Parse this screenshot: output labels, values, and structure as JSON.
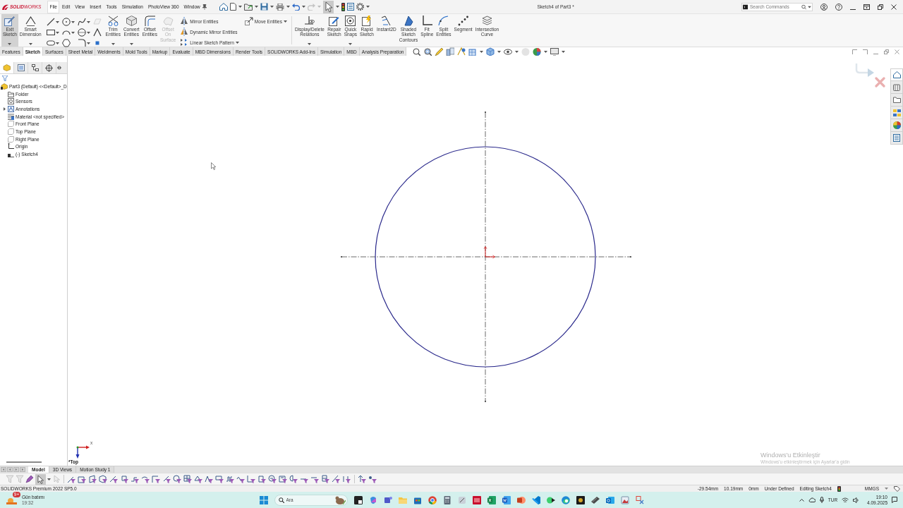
{
  "titlebar": {
    "logo": "**SOLID**WORKS",
    "menu": [
      {
        "label": "File",
        "selected": true
      },
      {
        "label": "Edit",
        "selected": false
      },
      {
        "label": "View",
        "selected": false
      },
      {
        "label": "Insert",
        "selected": false
      },
      {
        "label": "Tools",
        "selected": false
      },
      {
        "label": "Simulation",
        "selected": false
      },
      {
        "label": "PhotoView 360",
        "selected": false
      },
      {
        "label": "Window",
        "selected": false
      }
    ],
    "select_tool": {
      "pressed": true
    },
    "title": "Sketch4 of Part3 *",
    "search": {
      "placeholder": "Search Commands"
    }
  },
  "ribbon": {
    "main_tools": [
      {
        "label": "Exit Sketch",
        "pressed": true,
        "dropdown": true
      },
      {
        "label": "Smart Dimension",
        "pressed": false,
        "dropdown": true
      }
    ],
    "entity_tools": [
      {
        "label": "Trim Entities",
        "disabled": false,
        "dropdown": true
      },
      {
        "label": "Convert Entities",
        "disabled": false,
        "dropdown": true
      },
      {
        "label": "Offset Entities",
        "disabled": false,
        "dropdown": false
      },
      {
        "label": "Offset On Surface",
        "disabled": true,
        "dropdown": false
      }
    ],
    "pattern_tools": [
      {
        "label": "Mirror Entities",
        "dropdown": false
      },
      {
        "label": "Dynamic Mirror Entities",
        "dropdown": false
      },
      {
        "label": "Linear Sketch Pattern",
        "dropdown": true
      }
    ],
    "move_tool": {
      "label": "Move Entities",
      "dropdown": true
    },
    "relation_tools": [
      {
        "label": "Display/Delete Relations",
        "dropdown": true
      },
      {
        "label": "Repair Sketch",
        "dropdown": false
      },
      {
        "label": "Quick Snaps",
        "dropdown": true
      },
      {
        "label": "Rapid Sketch",
        "dropdown": false
      },
      {
        "label": "Instant2D",
        "dropdown": false
      },
      {
        "label": "Shaded Sketch Contours",
        "dropdown": false
      },
      {
        "label": "Fit Spline",
        "dropdown": false
      },
      {
        "label": "Split Entities",
        "dropdown": false
      },
      {
        "label": "Segment",
        "dropdown": false
      },
      {
        "label": "Intersection Curve",
        "dropdown": false
      }
    ]
  },
  "command_tabs": [
    {
      "label": "Features",
      "selected": false
    },
    {
      "label": "Sketch",
      "selected": true
    },
    {
      "label": "Surfaces",
      "selected": false
    },
    {
      "label": "Sheet Metal",
      "selected": false
    },
    {
      "label": "Weldments",
      "selected": false
    },
    {
      "label": "Mold Tools",
      "selected": false
    },
    {
      "label": "Markup",
      "selected": false
    },
    {
      "label": "Evaluate",
      "selected": false
    },
    {
      "label": "MBD Dimensions",
      "selected": false
    },
    {
      "label": "Render Tools",
      "selected": false
    },
    {
      "label": "SOLIDWORKS Add-Ins",
      "selected": false
    },
    {
      "label": "Simulation",
      "selected": false
    },
    {
      "label": "MBD",
      "selected": false
    },
    {
      "label": "Analysis Preparation",
      "selected": false
    }
  ],
  "feature_manager": {
    "tabs": [
      {
        "selected": true
      },
      {
        "selected": false
      },
      {
        "selected": false
      },
      {
        "selected": false
      }
    ],
    "root": {
      "kind": "part",
      "label": "Part3 (Default) <<Default>_D",
      "children": [
        {
          "kind": "folder",
          "label": "Folder"
        },
        {
          "kind": "sensors",
          "label": "Sensors"
        },
        {
          "kind": "annotations",
          "label": "Annotations",
          "expanded": false
        },
        {
          "kind": "material",
          "label": "Material <not specified>"
        },
        {
          "kind": "plane",
          "label": "Front Plane"
        },
        {
          "kind": "plane",
          "label": "Top Plane"
        },
        {
          "kind": "plane",
          "label": "Right Plane"
        },
        {
          "kind": "origin",
          "label": "Origin"
        },
        {
          "kind": "sketch",
          "label": "(-) Sketch4"
        }
      ]
    }
  },
  "graphics_area": {
    "triad_label": "x",
    "view_name": "*Top",
    "activation_notice": {
      "title": "Windows'u Etkinleştir",
      "text": "Windows'u etkinleştirmek için Ayarlar'a gidin"
    }
  },
  "task_pane": {
    "tabs": [
      {
        "selected": true
      },
      {
        "selected": false
      },
      {
        "selected": false
      },
      {
        "selected": false
      },
      {
        "selected": false
      },
      {
        "selected": false
      }
    ]
  },
  "bottom_tabs": [
    {
      "label": "Model",
      "selected": true
    },
    {
      "label": "3D Views",
      "selected": false
    },
    {
      "label": "Motion Study 1",
      "selected": false
    }
  ],
  "selection_filter": {
    "select_pressed": true
  },
  "status_bar": {
    "product": "SOLIDWORKS Premium 2022 SP5.0",
    "coordinates": [
      "-29.54mm",
      "10.19mm",
      "0mm"
    ],
    "sketch_status": "Under Defined",
    "editing": "Editing Sketch4",
    "units": "MMGS"
  },
  "taskbar": {
    "weather": {
      "badge": "9+",
      "label": "Gün batımı",
      "time": "19:32"
    },
    "search": {
      "placeholder": "Ara"
    },
    "language": "TUR",
    "clock": {
      "time": "19:10",
      "date": "4.09.2025"
    }
  }
}
